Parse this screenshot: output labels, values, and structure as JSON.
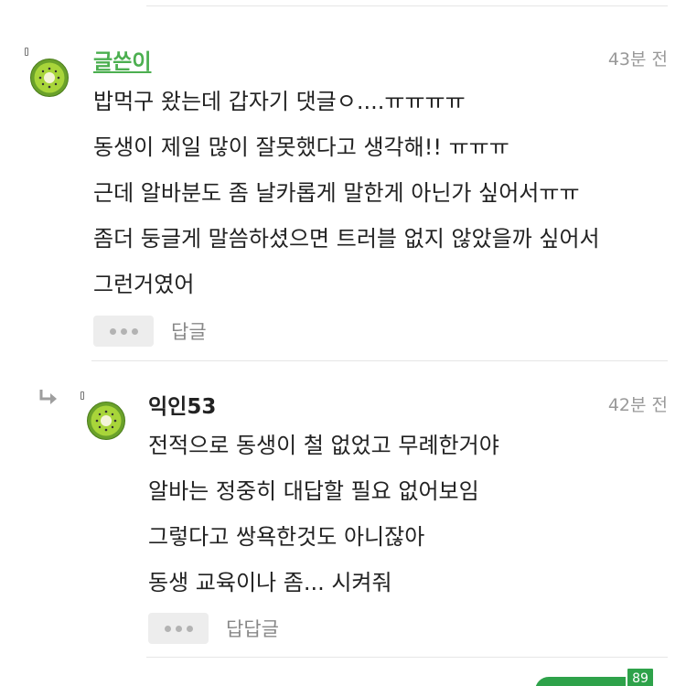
{
  "comments": [
    {
      "author": "글쓴이",
      "time": "43분 전",
      "lines": [
        "밥먹구 왔는데 갑자기 댓글ㅇ....ㅠㅠㅠㅠ",
        "동생이 제일 많이 잘못했다고 생각해!! ㅠㅠㅠ",
        "근데 알바분도 좀 날카롭게 말한게 아닌가 싶어서ㅠㅠ",
        "좀더 둥글게 말씀하셨으면 트러블 없지 않았을까 싶어서",
        "그런거였어"
      ],
      "reply_label": "답글"
    },
    {
      "author": "익인53",
      "time": "42분 전",
      "lines": [
        "전적으로 동생이 철 없었고 무례한거야",
        "알바는 정중히 대답할 필요 없어보임",
        "그렇다고 쌍욕한것도 아니잖아",
        "동생 교육이나 좀... 시켜줘"
      ],
      "reply_label": "답답글"
    }
  ],
  "floating_badge": "89",
  "icons": {
    "avatar": "kiwi-icon",
    "reply_marker": "reply-arrow-icon",
    "more": "more-dots-icon"
  },
  "colors": {
    "op_name": "#4caf50",
    "accent": "#2ea24a",
    "kiwi_skin": "#6aa12a",
    "kiwi_flesh": "#9acd32"
  }
}
